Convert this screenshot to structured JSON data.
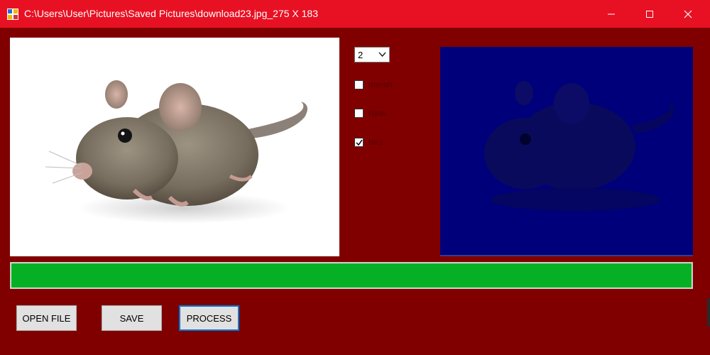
{
  "window": {
    "title": "C:\\Users\\User\\Pictures\\Saved Pictures\\download23.jpg_275 X 183",
    "controls": [
      "minimize-icon",
      "maximize-icon",
      "close-icon"
    ]
  },
  "combo": {
    "value": "2"
  },
  "channels": [
    {
      "label": "merah",
      "checked": false
    },
    {
      "label": "hijau",
      "checked": false
    },
    {
      "label": "biru",
      "checked": true
    }
  ],
  "progress": {
    "value_percent": 100,
    "color": "#06b025"
  },
  "buttons": {
    "open_file": "OPEN FILE",
    "save": "SAVE",
    "process": "PROCESS"
  },
  "colors": {
    "titlebar": "#e81123",
    "background": "#800000",
    "processed_image_tint": "#00007a"
  }
}
